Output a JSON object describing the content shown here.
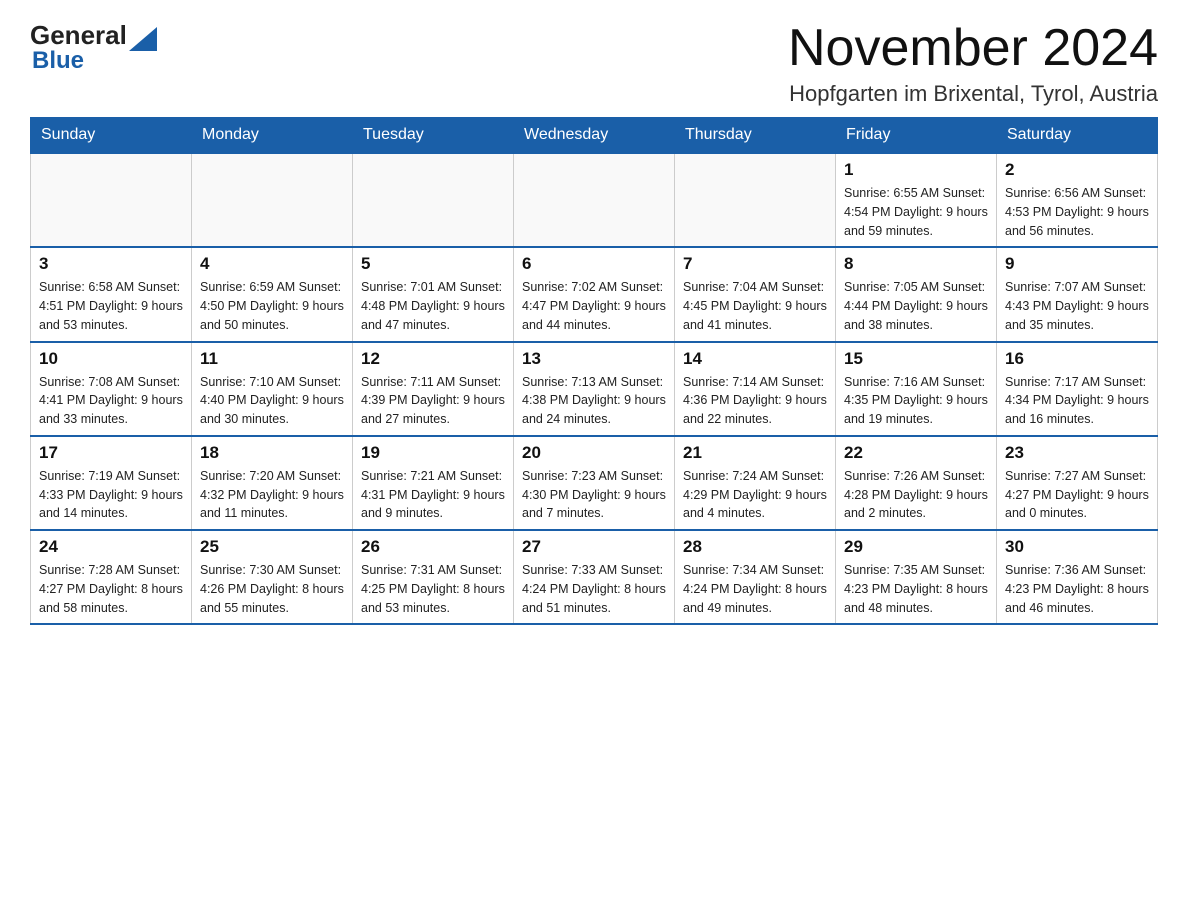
{
  "header": {
    "logo_general": "General",
    "logo_blue": "Blue",
    "month_title": "November 2024",
    "location": "Hopfgarten im Brixental, Tyrol, Austria"
  },
  "days_of_week": [
    "Sunday",
    "Monday",
    "Tuesday",
    "Wednesday",
    "Thursday",
    "Friday",
    "Saturday"
  ],
  "weeks": [
    [
      {
        "day": "",
        "info": ""
      },
      {
        "day": "",
        "info": ""
      },
      {
        "day": "",
        "info": ""
      },
      {
        "day": "",
        "info": ""
      },
      {
        "day": "",
        "info": ""
      },
      {
        "day": "1",
        "info": "Sunrise: 6:55 AM\nSunset: 4:54 PM\nDaylight: 9 hours and 59 minutes."
      },
      {
        "day": "2",
        "info": "Sunrise: 6:56 AM\nSunset: 4:53 PM\nDaylight: 9 hours and 56 minutes."
      }
    ],
    [
      {
        "day": "3",
        "info": "Sunrise: 6:58 AM\nSunset: 4:51 PM\nDaylight: 9 hours and 53 minutes."
      },
      {
        "day": "4",
        "info": "Sunrise: 6:59 AM\nSunset: 4:50 PM\nDaylight: 9 hours and 50 minutes."
      },
      {
        "day": "5",
        "info": "Sunrise: 7:01 AM\nSunset: 4:48 PM\nDaylight: 9 hours and 47 minutes."
      },
      {
        "day": "6",
        "info": "Sunrise: 7:02 AM\nSunset: 4:47 PM\nDaylight: 9 hours and 44 minutes."
      },
      {
        "day": "7",
        "info": "Sunrise: 7:04 AM\nSunset: 4:45 PM\nDaylight: 9 hours and 41 minutes."
      },
      {
        "day": "8",
        "info": "Sunrise: 7:05 AM\nSunset: 4:44 PM\nDaylight: 9 hours and 38 minutes."
      },
      {
        "day": "9",
        "info": "Sunrise: 7:07 AM\nSunset: 4:43 PM\nDaylight: 9 hours and 35 minutes."
      }
    ],
    [
      {
        "day": "10",
        "info": "Sunrise: 7:08 AM\nSunset: 4:41 PM\nDaylight: 9 hours and 33 minutes."
      },
      {
        "day": "11",
        "info": "Sunrise: 7:10 AM\nSunset: 4:40 PM\nDaylight: 9 hours and 30 minutes."
      },
      {
        "day": "12",
        "info": "Sunrise: 7:11 AM\nSunset: 4:39 PM\nDaylight: 9 hours and 27 minutes."
      },
      {
        "day": "13",
        "info": "Sunrise: 7:13 AM\nSunset: 4:38 PM\nDaylight: 9 hours and 24 minutes."
      },
      {
        "day": "14",
        "info": "Sunrise: 7:14 AM\nSunset: 4:36 PM\nDaylight: 9 hours and 22 minutes."
      },
      {
        "day": "15",
        "info": "Sunrise: 7:16 AM\nSunset: 4:35 PM\nDaylight: 9 hours and 19 minutes."
      },
      {
        "day": "16",
        "info": "Sunrise: 7:17 AM\nSunset: 4:34 PM\nDaylight: 9 hours and 16 minutes."
      }
    ],
    [
      {
        "day": "17",
        "info": "Sunrise: 7:19 AM\nSunset: 4:33 PM\nDaylight: 9 hours and 14 minutes."
      },
      {
        "day": "18",
        "info": "Sunrise: 7:20 AM\nSunset: 4:32 PM\nDaylight: 9 hours and 11 minutes."
      },
      {
        "day": "19",
        "info": "Sunrise: 7:21 AM\nSunset: 4:31 PM\nDaylight: 9 hours and 9 minutes."
      },
      {
        "day": "20",
        "info": "Sunrise: 7:23 AM\nSunset: 4:30 PM\nDaylight: 9 hours and 7 minutes."
      },
      {
        "day": "21",
        "info": "Sunrise: 7:24 AM\nSunset: 4:29 PM\nDaylight: 9 hours and 4 minutes."
      },
      {
        "day": "22",
        "info": "Sunrise: 7:26 AM\nSunset: 4:28 PM\nDaylight: 9 hours and 2 minutes."
      },
      {
        "day": "23",
        "info": "Sunrise: 7:27 AM\nSunset: 4:27 PM\nDaylight: 9 hours and 0 minutes."
      }
    ],
    [
      {
        "day": "24",
        "info": "Sunrise: 7:28 AM\nSunset: 4:27 PM\nDaylight: 8 hours and 58 minutes."
      },
      {
        "day": "25",
        "info": "Sunrise: 7:30 AM\nSunset: 4:26 PM\nDaylight: 8 hours and 55 minutes."
      },
      {
        "day": "26",
        "info": "Sunrise: 7:31 AM\nSunset: 4:25 PM\nDaylight: 8 hours and 53 minutes."
      },
      {
        "day": "27",
        "info": "Sunrise: 7:33 AM\nSunset: 4:24 PM\nDaylight: 8 hours and 51 minutes."
      },
      {
        "day": "28",
        "info": "Sunrise: 7:34 AM\nSunset: 4:24 PM\nDaylight: 8 hours and 49 minutes."
      },
      {
        "day": "29",
        "info": "Sunrise: 7:35 AM\nSunset: 4:23 PM\nDaylight: 8 hours and 48 minutes."
      },
      {
        "day": "30",
        "info": "Sunrise: 7:36 AM\nSunset: 4:23 PM\nDaylight: 8 hours and 46 minutes."
      }
    ]
  ]
}
